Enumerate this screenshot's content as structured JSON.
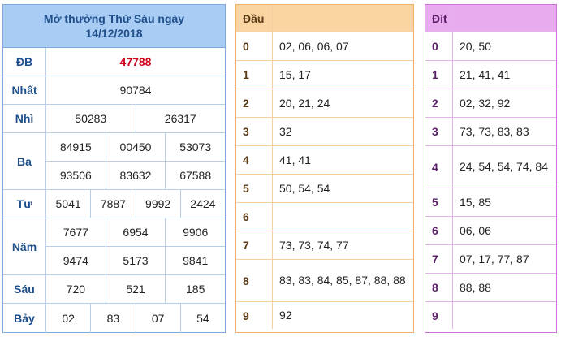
{
  "results": {
    "title_line1": "Mở thưởng Thứ Sáu ngày",
    "title_line2": "14/12/2018",
    "rows": [
      {
        "label": "ĐB",
        "lines": [
          [
            "47788"
          ]
        ]
      },
      {
        "label": "Nhất",
        "lines": [
          [
            "90784"
          ]
        ]
      },
      {
        "label": "Nhì",
        "lines": [
          [
            "50283",
            "26317"
          ]
        ]
      },
      {
        "label": "Ba",
        "lines": [
          [
            "84915",
            "00450",
            "53073"
          ],
          [
            "93506",
            "83632",
            "67588"
          ]
        ]
      },
      {
        "label": "Tư",
        "lines": [
          [
            "5041",
            "7887",
            "9992",
            "2424"
          ]
        ]
      },
      {
        "label": "Năm",
        "lines": [
          [
            "7677",
            "6954",
            "9906"
          ],
          [
            "9474",
            "5173",
            "9841"
          ]
        ]
      },
      {
        "label": "Sáu",
        "lines": [
          [
            "720",
            "521",
            "185"
          ]
        ]
      },
      {
        "label": "Bảy",
        "lines": [
          [
            "02",
            "83",
            "07",
            "54"
          ]
        ]
      }
    ]
  },
  "dau": {
    "header": "Đầu",
    "rows": [
      {
        "key": "0",
        "value": "02, 06, 06, 07"
      },
      {
        "key": "1",
        "value": "15, 17"
      },
      {
        "key": "2",
        "value": "20, 21, 24"
      },
      {
        "key": "3",
        "value": "32"
      },
      {
        "key": "4",
        "value": "41, 41"
      },
      {
        "key": "5",
        "value": "50, 54, 54"
      },
      {
        "key": "6",
        "value": ""
      },
      {
        "key": "7",
        "value": "73, 73, 74, 77"
      },
      {
        "key": "8",
        "value": "83, 83, 84, 85, 87, 88, 88"
      },
      {
        "key": "9",
        "value": "92"
      }
    ]
  },
  "dit": {
    "header": "Đít",
    "rows": [
      {
        "key": "0",
        "value": "20, 50"
      },
      {
        "key": "1",
        "value": "21, 41, 41"
      },
      {
        "key": "2",
        "value": "02, 32, 92"
      },
      {
        "key": "3",
        "value": "73, 73, 83, 83"
      },
      {
        "key": "4",
        "value": "24, 54, 54, 74, 84"
      },
      {
        "key": "5",
        "value": "15, 85"
      },
      {
        "key": "6",
        "value": "06, 06"
      },
      {
        "key": "7",
        "value": "07, 17, 77, 87"
      },
      {
        "key": "8",
        "value": "88, 88"
      },
      {
        "key": "9",
        "value": ""
      }
    ]
  },
  "colors": {
    "results_header_bg": "#a9ccf4",
    "special_prize": "#d0021b",
    "dau_header_bg": "#fbd5a1",
    "dit_header_bg": "#e7abee"
  }
}
